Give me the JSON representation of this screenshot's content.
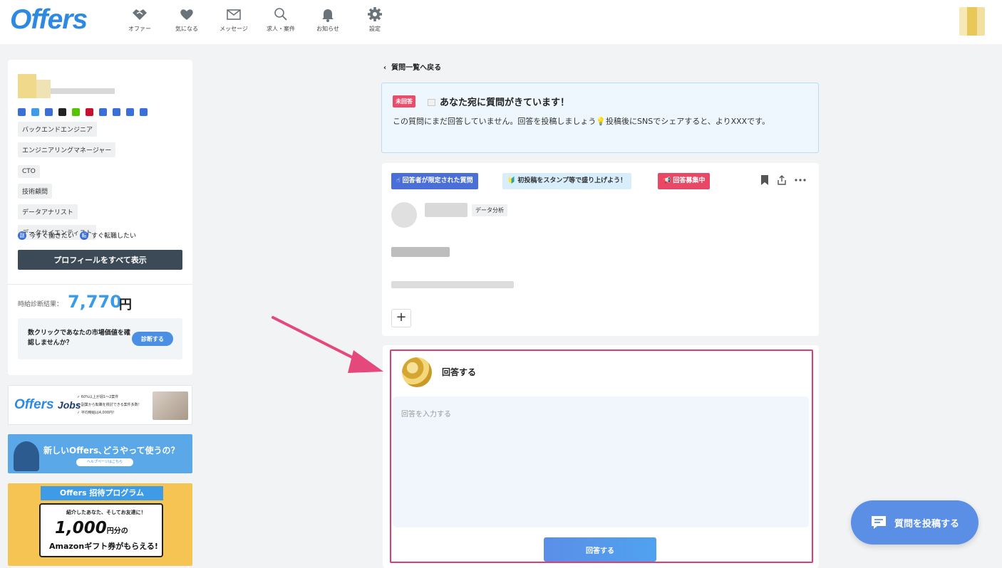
{
  "header": {
    "logo": "Offers",
    "nav": [
      {
        "label": "オファー",
        "icon": "handshake-icon"
      },
      {
        "label": "気になる",
        "icon": "heart-icon"
      },
      {
        "label": "メッセージ",
        "icon": "mail-icon"
      },
      {
        "label": "求人・案件",
        "icon": "search-icon"
      },
      {
        "label": "お知らせ",
        "icon": "bell-icon"
      },
      {
        "label": "設定",
        "icon": "gear-icon"
      }
    ]
  },
  "profile": {
    "tags": [
      "バックエンドエンジニア",
      "エンジニアリングマネージャー",
      "CTO",
      "技術顧問",
      "データアナリスト",
      "データサイエンティスト"
    ],
    "status": [
      {
        "badge": "副",
        "label": "今すぐ働きたい"
      },
      {
        "badge": "転",
        "label": "すぐ転職したい"
      }
    ],
    "show_all_button": "プロフィールをすべて表示",
    "salary_label": "時給診断結果：",
    "salary_value": "7,770",
    "salary_unit": "円",
    "diagnose_text": "数クリックであなたの市場価値を確認しませんか？",
    "diagnose_button": "診断する"
  },
  "banners": {
    "jobs_logo": "Offers",
    "jobs_logo_sub": "Jobs",
    "jobs_points": [
      "✓ 60%以上が週1〜2案件",
      "✓ 副業から転職を検討できる案件多数！",
      "✓ 平均時給は4,000円！"
    ],
    "help_text": "新しいOffers､どうやって使うの？",
    "help_pill": "ヘルプページはこちら",
    "invite_title": "Offers 招待プログラム",
    "invite_sub": "紹介したあなた、そしてお友達に！",
    "invite_amount": "1,000",
    "invite_unit": "円分の",
    "invite_gift": "Amazonギフト券がもらえる!"
  },
  "main": {
    "back_link": "質問一覧へ戻る",
    "notice": {
      "badge": "未回答",
      "title": "あなた宛に質問がきています！",
      "body": "この質問にまだ回答していません。回答を投稿しましょう💡投稿後にSNSでシェアすると、よりXXXです。"
    },
    "question": {
      "badges": [
        "☝ 回答者が限定された質問",
        "🔰 初投稿をスタンプ等で盛り上げよう！",
        "📢 回答募集中"
      ],
      "category": "データ分析"
    },
    "answer": {
      "title": "回答する",
      "placeholder": "回答を入力する",
      "submit": "回答する"
    }
  },
  "fab_label": "質問を投稿する",
  "colors": {
    "brand": "#2d8ae0",
    "highlight": "#e03e6e",
    "badge_red": "#ea4d6b",
    "badge_blue": "#4b6fd9"
  }
}
